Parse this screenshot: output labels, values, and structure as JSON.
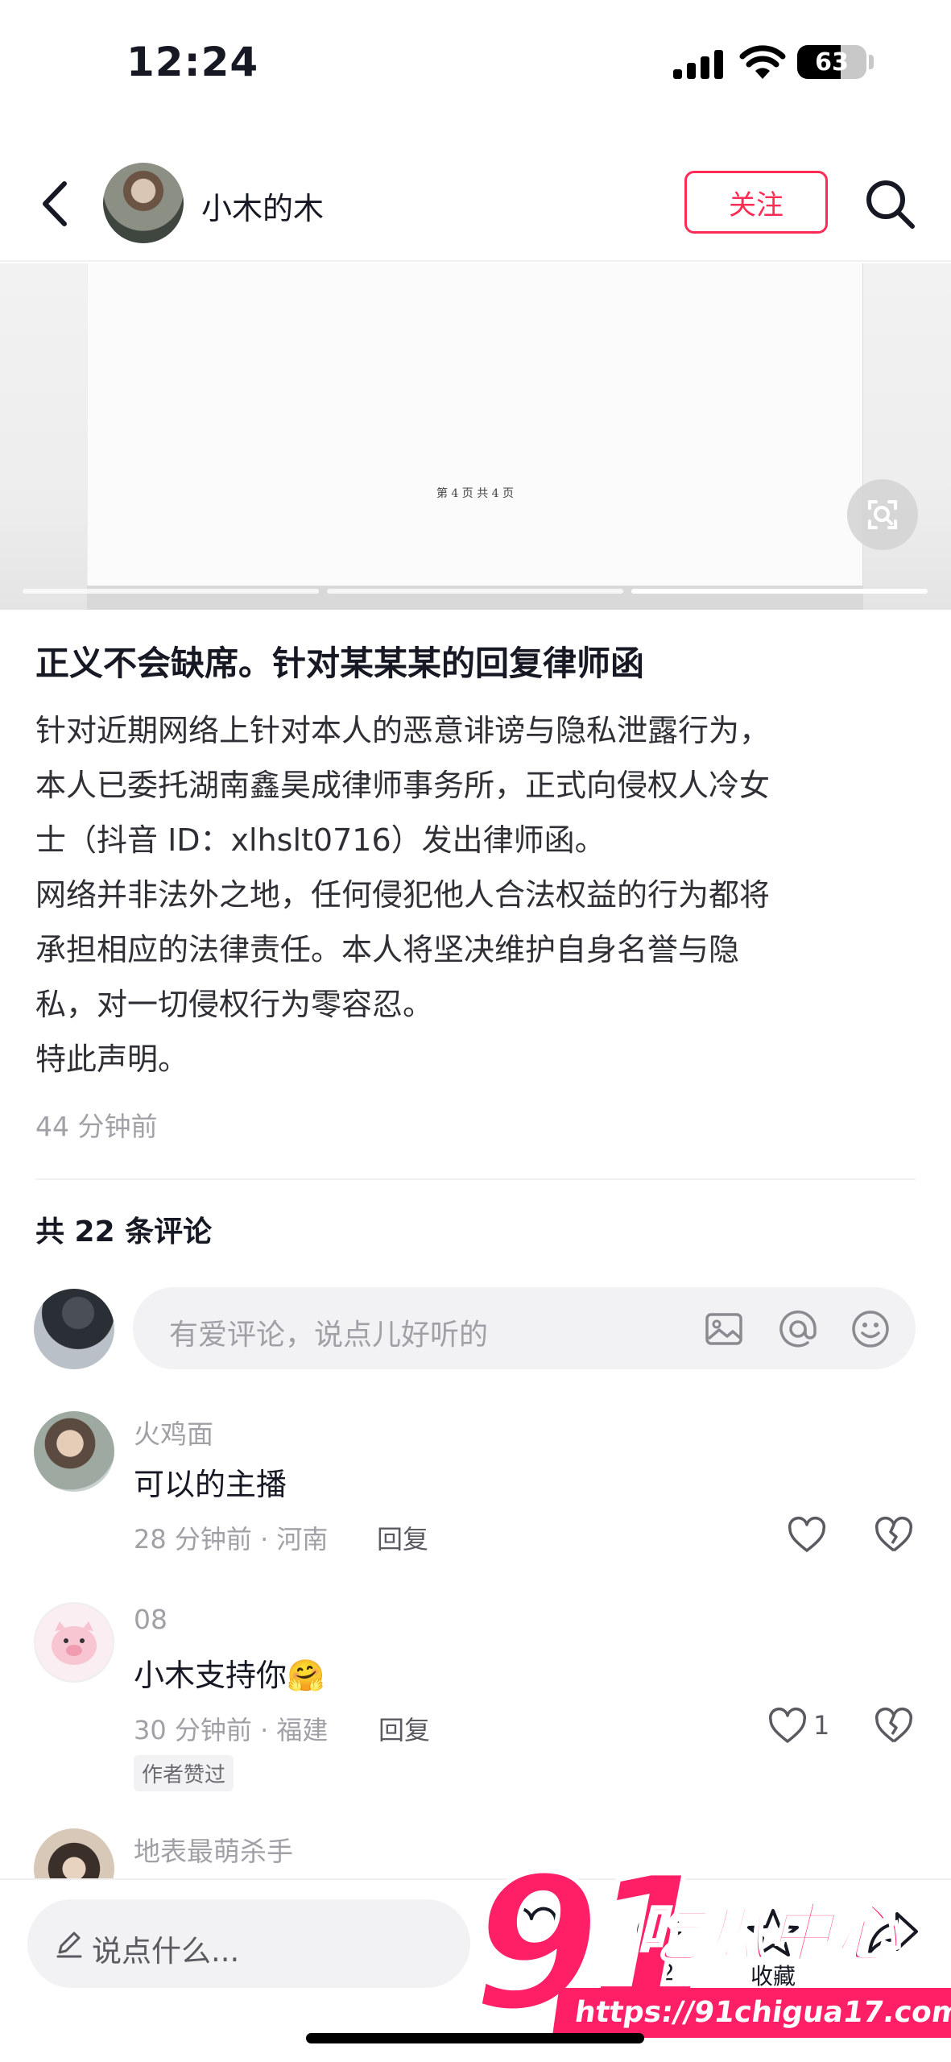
{
  "status_bar": {
    "time": "12:24",
    "battery": "63",
    "battery_level": 0.63
  },
  "header": {
    "author_name": "小木的木",
    "follow_label": "关注"
  },
  "carousel": {
    "page_footer": "第 4 页 共 4 页",
    "current_index": 3,
    "total": 3
  },
  "post": {
    "title": "正义不会缺席。针对某某某的回复律师函",
    "body_lines": [
      "针对近期网络上针对本人的恶意诽谤与隐私泄露行为，",
      "本人已委托湖南鑫昊成律师事务所，正式向侵权人冷女",
      "士（抖音 ID：xlhslt0716）发出律师函。",
      "网络并非法外之地，任何侵犯他人合法权益的行为都将",
      "承担相应的法律责任。本人将坚决维护自身名誉与隐",
      "私，对一切侵权行为零容忍。",
      "特此声明。"
    ],
    "time": "44 分钟前"
  },
  "comments_section": {
    "count_label": "共 22 条评论",
    "input_placeholder": "有爱评论，说点儿好听的",
    "icons": [
      "image-icon",
      "at-icon",
      "emoji-icon"
    ]
  },
  "comments": [
    {
      "name": "火鸡面",
      "text": "可以的主播",
      "meta": "28 分钟前 · 河南",
      "reply": "回复",
      "likes": "",
      "badge": ""
    },
    {
      "name": "08",
      "text": "小木支持你",
      "emoji": "🤗",
      "meta": "30 分钟前 · 福建",
      "reply": "回复",
      "likes": "1",
      "badge": "作者赞过"
    },
    {
      "name": "地表最萌杀手",
      "text": "",
      "meta": "",
      "reply": "",
      "likes": "",
      "badge": ""
    }
  ],
  "bottom_bar": {
    "placeholder": "说点什么...",
    "like_count": "",
    "comment_count": "22",
    "collect_label": "收藏",
    "share_label": ""
  },
  "watermark": {
    "number": "91",
    "name": "吃瓜中心",
    "url": "https://91chigua17.com"
  },
  "colors": {
    "accent": "#fe2c55",
    "text": "#161823",
    "secondary": "#a0a1a6",
    "watermark": "#ff1f67"
  }
}
